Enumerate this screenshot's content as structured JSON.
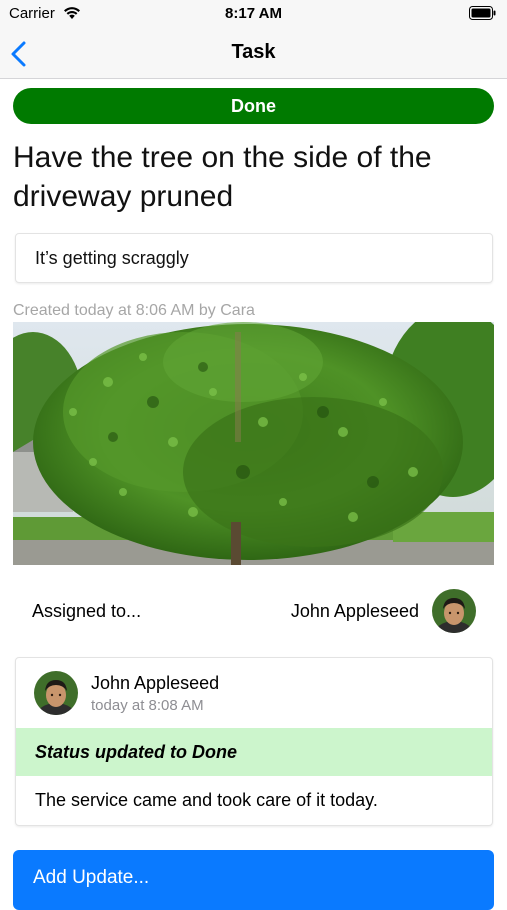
{
  "status_bar": {
    "carrier": "Carrier",
    "time": "8:17 AM",
    "wifi_icon": "wifi-icon",
    "battery_icon": "battery-icon"
  },
  "nav": {
    "title": "Task",
    "back_icon": "chevron-left-icon"
  },
  "task": {
    "status_label": "Done",
    "status_color": "#007a00",
    "title": "Have the tree on the side of the driveway pruned",
    "description": "It’s getting scraggly",
    "created_meta": "Created today at 8:06 AM by Cara"
  },
  "assignment": {
    "label": "Assigned to...",
    "assignee": "John Appleseed"
  },
  "update": {
    "author": "John Appleseed",
    "time": "today at 8:08 AM",
    "status_text": "Status updated to Done",
    "status_bg": "#ccf5cc",
    "body": "The service came and took care of it today."
  },
  "actions": {
    "add_update_label": "Add Update...",
    "accent": "#0a7aff"
  }
}
